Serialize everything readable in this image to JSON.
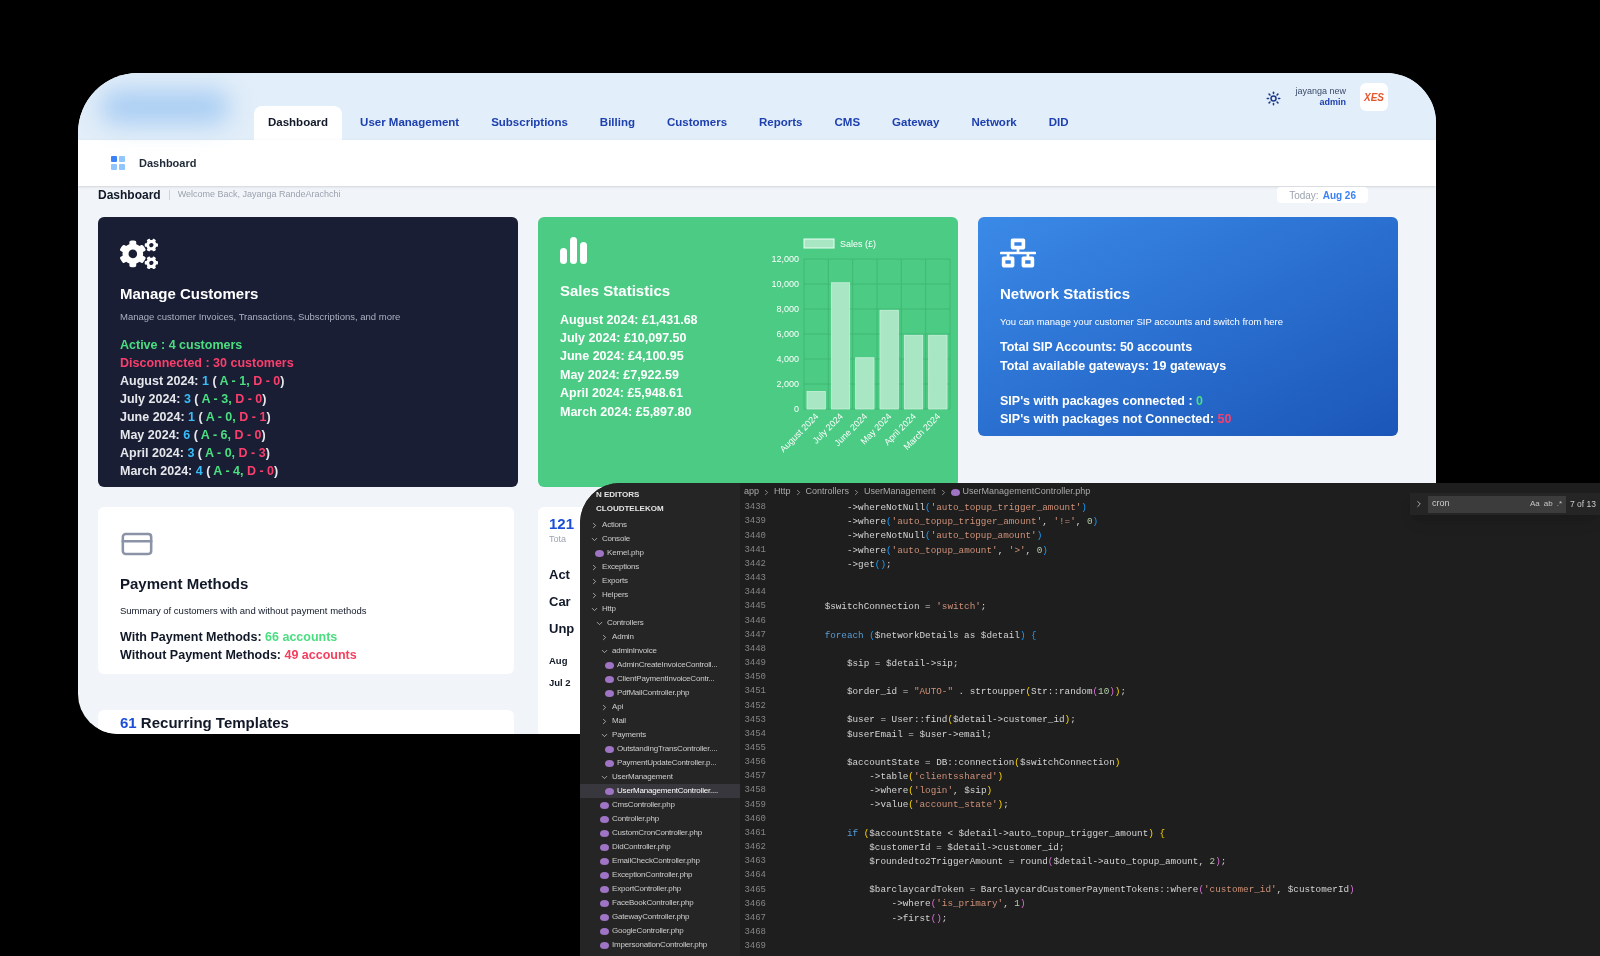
{
  "dashboard": {
    "user": {
      "name": "jayanga new",
      "role": "admin",
      "avatar": "XES"
    },
    "tabs": [
      {
        "label": "Dashboard",
        "selected": true
      },
      {
        "label": "User Management",
        "selected": false
      },
      {
        "label": "Subscriptions",
        "selected": false
      },
      {
        "label": "Billing",
        "selected": false
      },
      {
        "label": "Customers",
        "selected": false
      },
      {
        "label": "Reports",
        "selected": false
      },
      {
        "label": "CMS",
        "selected": false
      },
      {
        "label": "Gateway",
        "selected": false
      },
      {
        "label": "Network",
        "selected": false
      },
      {
        "label": "DID",
        "selected": false
      }
    ],
    "breadcrumb": "Dashboard",
    "page_title": "Dashboard",
    "welcome": "Welcome Back, Jayanga RandeArachchi",
    "today_label": "Today:",
    "today_value": "Aug 26",
    "manage_customers": {
      "title": "Manage Customers",
      "subtitle": "Manage customer Invoices, Transactions, Subscriptions, and more",
      "lines": [
        {
          "segments": [
            {
              "text": "Active : 4 customers",
              "kind": "active"
            }
          ]
        },
        {
          "segments": [
            {
              "text": "Disconnected : 30 customers",
              "kind": "disconnected"
            }
          ]
        },
        {
          "segments": [
            {
              "text": "August 2024: ",
              "kind": "label"
            },
            {
              "text": "1",
              "kind": "count"
            },
            {
              "text": " ( ",
              "kind": "label"
            },
            {
              "text": "A - 1,",
              "kind": "active"
            },
            {
              "text": " D - 0",
              "kind": "disconnected"
            },
            {
              "text": ")",
              "kind": "label"
            }
          ]
        },
        {
          "segments": [
            {
              "text": "July 2024: ",
              "kind": "label"
            },
            {
              "text": "3",
              "kind": "count"
            },
            {
              "text": " ( ",
              "kind": "label"
            },
            {
              "text": "A - 3,",
              "kind": "active"
            },
            {
              "text": " D - 0",
              "kind": "disconnected"
            },
            {
              "text": ")",
              "kind": "label"
            }
          ]
        },
        {
          "segments": [
            {
              "text": "June 2024: ",
              "kind": "label"
            },
            {
              "text": "1",
              "kind": "count"
            },
            {
              "text": " ( ",
              "kind": "label"
            },
            {
              "text": "A - 0,",
              "kind": "active"
            },
            {
              "text": " D - 1",
              "kind": "disconnected"
            },
            {
              "text": ")",
              "kind": "label"
            }
          ]
        },
        {
          "segments": [
            {
              "text": "May 2024: ",
              "kind": "label"
            },
            {
              "text": "6",
              "kind": "count"
            },
            {
              "text": " ( ",
              "kind": "label"
            },
            {
              "text": "A - 6,",
              "kind": "active"
            },
            {
              "text": " D - 0",
              "kind": "disconnected"
            },
            {
              "text": ")",
              "kind": "label"
            }
          ]
        },
        {
          "segments": [
            {
              "text": "April 2024: ",
              "kind": "label"
            },
            {
              "text": "3",
              "kind": "count"
            },
            {
              "text": " ( ",
              "kind": "label"
            },
            {
              "text": "A - 0,",
              "kind": "active"
            },
            {
              "text": " D - 3",
              "kind": "disconnected"
            },
            {
              "text": ")",
              "kind": "label"
            }
          ]
        },
        {
          "segments": [
            {
              "text": "March 2024: ",
              "kind": "label"
            },
            {
              "text": "4",
              "kind": "count"
            },
            {
              "text": " ( ",
              "kind": "label"
            },
            {
              "text": "A - 4,",
              "kind": "active"
            },
            {
              "text": " D - 0",
              "kind": "disconnected"
            },
            {
              "text": ")",
              "kind": "label"
            }
          ]
        }
      ]
    },
    "sales_statistics": {
      "title": "Sales Statistics",
      "lines": [
        "August 2024: £1,431.68",
        "July 2024: £10,097.50",
        "June 2024: £4,100.95",
        "May 2024: £7,922.59",
        "April 2024: £5,948.61",
        "March 2024: £5,897.80"
      ],
      "chart_data": {
        "type": "bar",
        "grid": true,
        "categories": [
          "August 2024",
          "July 2024",
          "June 2024",
          "May 2024",
          "April 2024",
          "March 2024"
        ],
        "series": [
          {
            "name": "Sales (£)",
            "color": "#a8e6c4",
            "values": [
              1400,
              10100,
              4100,
              7900,
              5900,
              5900
            ]
          }
        ],
        "ylim": [
          0,
          12000
        ],
        "yticks": [
          {
            "value": 0,
            "label": "0"
          },
          {
            "value": 2000,
            "label": "2,000"
          },
          {
            "value": 4000,
            "label": "4,000"
          },
          {
            "value": 6000,
            "label": "6,000"
          },
          {
            "value": 8000,
            "label": "8,000"
          },
          {
            "value": 10000,
            "label": "10,000"
          },
          {
            "value": 12000,
            "label": "12,000"
          }
        ]
      }
    },
    "network_statistics": {
      "title": "Network Statistics",
      "subtitle": "You can manage your customer SIP accounts and switch from here",
      "totals": [
        "Total SIP Accounts: 50 accounts",
        "Total available gateways: 19 gateways"
      ],
      "lines": [
        {
          "segments": [
            {
              "text": "SIP's with packages connected : ",
              "kind": "label"
            },
            {
              "text": "0",
              "kind": "active"
            }
          ]
        },
        {
          "segments": [
            {
              "text": "SIP's with packages not Connected: ",
              "kind": "label"
            },
            {
              "text": "50",
              "kind": "disconnected"
            }
          ]
        }
      ]
    },
    "payment_methods": {
      "title": "Payment Methods",
      "subtitle": "Summary of customers with and without payment methods",
      "lines": [
        {
          "segments": [
            {
              "text": "With Payment Methods: ",
              "kind": "label"
            },
            {
              "text": "66 accounts",
              "kind": "active"
            }
          ]
        },
        {
          "segments": [
            {
              "text": "Without Payment Methods: ",
              "kind": "label"
            },
            {
              "text": "49 accounts",
              "kind": "disconnected"
            }
          ]
        }
      ]
    },
    "partial_card": {
      "total": "121",
      "total_label": "Tota",
      "items": [
        "Act",
        "Car",
        "Unp"
      ],
      "months": [
        "Aug",
        "Jul 2"
      ]
    },
    "recurring": {
      "count": "61",
      "label": "Recurring Templates"
    }
  },
  "editor": {
    "explorer_headers": [
      "N EDITORS",
      "CLOUDTELEKOM"
    ],
    "tree": [
      {
        "label": "Actions",
        "kind": "folder",
        "expanded": false,
        "selected": false
      },
      {
        "label": "Console",
        "kind": "folder",
        "expanded": true,
        "selected": false,
        "children": [
          {
            "label": "Kernel.php",
            "kind": "file",
            "selected": false
          }
        ]
      },
      {
        "label": "Exceptions",
        "kind": "folder",
        "expanded": false,
        "selected": false
      },
      {
        "label": "Exports",
        "kind": "folder",
        "expanded": false,
        "selected": false
      },
      {
        "label": "Helpers",
        "kind": "folder",
        "expanded": false,
        "selected": false
      },
      {
        "label": "Http",
        "kind": "folder",
        "expanded": true,
        "selected": false,
        "children": [
          {
            "label": "Controllers",
            "kind": "folder",
            "expanded": true,
            "selected": false,
            "children": [
              {
                "label": "Admin",
                "kind": "folder",
                "expanded": false,
                "selected": false
              },
              {
                "label": "adminInvoice",
                "kind": "folder",
                "expanded": true,
                "selected": false,
                "children": [
                  {
                    "label": "AdminCreateInvoiceControll...",
                    "kind": "file",
                    "selected": false
                  },
                  {
                    "label": "ClientPaymentInvoiceContr...",
                    "kind": "file",
                    "selected": false
                  },
                  {
                    "label": "PdfMailController.php",
                    "kind": "file",
                    "selected": false
                  }
                ]
              },
              {
                "label": "Api",
                "kind": "folder",
                "expanded": false,
                "selected": false
              },
              {
                "label": "Mail",
                "kind": "folder",
                "expanded": false,
                "selected": false
              },
              {
                "label": "Payments",
                "kind": "folder",
                "expanded": true,
                "selected": false,
                "children": [
                  {
                    "label": "OutstandingTransController....",
                    "kind": "file",
                    "selected": false
                  },
                  {
                    "label": "PaymentUpdateController.p...",
                    "kind": "file",
                    "selected": false
                  }
                ]
              },
              {
                "label": "UserManagement",
                "kind": "folder",
                "expanded": true,
                "selected": false,
                "children": [
                  {
                    "label": "UserManagementController....",
                    "kind": "file",
                    "selected": true
                  }
                ]
              },
              {
                "label": "CmsController.php",
                "kind": "file",
                "selected": false
              },
              {
                "label": "Controller.php",
                "kind": "file",
                "selected": false
              },
              {
                "label": "CustomCronController.php",
                "kind": "file",
                "selected": false
              },
              {
                "label": "DidController.php",
                "kind": "file",
                "selected": false
              },
              {
                "label": "EmailCheckController.php",
                "kind": "file",
                "selected": false
              },
              {
                "label": "ExceptionController.php",
                "kind": "file",
                "selected": false
              },
              {
                "label": "ExportController.php",
                "kind": "file",
                "selected": false
              },
              {
                "label": "FaceBookController.php",
                "kind": "file",
                "selected": false
              },
              {
                "label": "GatewayController.php",
                "kind": "file",
                "selected": false
              },
              {
                "label": "GoogleController.php",
                "kind": "file",
                "selected": false
              },
              {
                "label": "ImpersonationController.php",
                "kind": "file",
                "selected": false
              }
            ]
          }
        ]
      }
    ],
    "breadcrumb": [
      "app",
      "Http",
      "Controllers",
      "UserManagement",
      "UserManagementController.php"
    ],
    "find": {
      "value": "cron",
      "toggles": [
        "Aa",
        "ab",
        ".*"
      ],
      "count": "7 of 13"
    },
    "lines": [
      {
        "number": "3438",
        "segments": [
          {
            "text": "            ->whereNotNull",
            "kind": "plain"
          },
          {
            "text": "(",
            "kind": "p3"
          },
          {
            "text": "'auto_topup_trigger_amount'",
            "kind": "string"
          },
          {
            "text": ")",
            "kind": "p3"
          }
        ]
      },
      {
        "number": "3439",
        "segments": [
          {
            "text": "            ->where",
            "kind": "plain"
          },
          {
            "text": "(",
            "kind": "p3"
          },
          {
            "text": "'auto_topup_trigger_amount'",
            "kind": "string"
          },
          {
            "text": ", ",
            "kind": "plain"
          },
          {
            "text": "'!='",
            "kind": "string"
          },
          {
            "text": ", ",
            "kind": "plain"
          },
          {
            "text": "0",
            "kind": "number"
          },
          {
            "text": ")",
            "kind": "p3"
          }
        ]
      },
      {
        "number": "3440",
        "segments": [
          {
            "text": "            ->whereNotNull",
            "kind": "plain"
          },
          {
            "text": "(",
            "kind": "p3"
          },
          {
            "text": "'auto_topup_amount'",
            "kind": "string"
          },
          {
            "text": ")",
            "kind": "p3"
          }
        ]
      },
      {
        "number": "3441",
        "segments": [
          {
            "text": "            ->where",
            "kind": "plain"
          },
          {
            "text": "(",
            "kind": "p3"
          },
          {
            "text": "'auto_topup_amount'",
            "kind": "string"
          },
          {
            "text": ", ",
            "kind": "plain"
          },
          {
            "text": "'>'",
            "kind": "string"
          },
          {
            "text": ", ",
            "kind": "plain"
          },
          {
            "text": "0",
            "kind": "number"
          },
          {
            "text": ")",
            "kind": "p3"
          }
        ]
      },
      {
        "number": "3442",
        "segments": [
          {
            "text": "            ->get",
            "kind": "plain"
          },
          {
            "text": "()",
            "kind": "p3"
          },
          {
            "text": ";",
            "kind": "plain"
          }
        ]
      },
      {
        "number": "3443"
      },
      {
        "number": "3444"
      },
      {
        "number": "3445",
        "segments": [
          {
            "text": "        $switchConnection = ",
            "kind": "plain"
          },
          {
            "text": "'switch'",
            "kind": "string"
          },
          {
            "text": ";",
            "kind": "plain"
          }
        ]
      },
      {
        "number": "3446"
      },
      {
        "number": "3447",
        "segments": [
          {
            "text": "        foreach",
            "kind": "keyword"
          },
          {
            "text": " (",
            "kind": "p3"
          },
          {
            "text": "$networkDetails as $detail",
            "kind": "plain"
          },
          {
            "text": ")",
            "kind": "p3"
          },
          {
            "text": " {",
            "kind": "p3"
          }
        ]
      },
      {
        "number": "3448"
      },
      {
        "number": "3449",
        "segments": [
          {
            "text": "            $sip = $detail->sip;",
            "kind": "plain"
          }
        ]
      },
      {
        "number": "3450"
      },
      {
        "number": "3451",
        "segments": [
          {
            "text": "            $order_id = ",
            "kind": "plain"
          },
          {
            "text": "\"AUTO-\"",
            "kind": "string"
          },
          {
            "text": " . strtoupper",
            "kind": "plain"
          },
          {
            "text": "(",
            "kind": "p1"
          },
          {
            "text": "Str::random",
            "kind": "plain"
          },
          {
            "text": "(",
            "kind": "p2"
          },
          {
            "text": "10",
            "kind": "number"
          },
          {
            "text": ")",
            "kind": "p2"
          },
          {
            "text": ")",
            "kind": "p1"
          },
          {
            "text": ";",
            "kind": "plain"
          }
        ]
      },
      {
        "number": "3452"
      },
      {
        "number": "3453",
        "segments": [
          {
            "text": "            $user = User::find",
            "kind": "plain"
          },
          {
            "text": "(",
            "kind": "p1"
          },
          {
            "text": "$detail->customer_id",
            "kind": "plain"
          },
          {
            "text": ")",
            "kind": "p1"
          },
          {
            "text": ";",
            "kind": "plain"
          }
        ]
      },
      {
        "number": "3454",
        "segments": [
          {
            "text": "            $userEmail = $user->email;",
            "kind": "plain"
          }
        ]
      },
      {
        "number": "3455"
      },
      {
        "number": "3456",
        "segments": [
          {
            "text": "            $accountState = DB::connection",
            "kind": "plain"
          },
          {
            "text": "(",
            "kind": "p1"
          },
          {
            "text": "$switchConnection",
            "kind": "plain"
          },
          {
            "text": ")",
            "kind": "p1"
          }
        ]
      },
      {
        "number": "3457",
        "segments": [
          {
            "text": "                ->table",
            "kind": "plain"
          },
          {
            "text": "(",
            "kind": "p1"
          },
          {
            "text": "'clientsshared'",
            "kind": "string"
          },
          {
            "text": ")",
            "kind": "p1"
          }
        ]
      },
      {
        "number": "3458",
        "segments": [
          {
            "text": "                ->where",
            "kind": "plain"
          },
          {
            "text": "(",
            "kind": "p1"
          },
          {
            "text": "'login'",
            "kind": "string"
          },
          {
            "text": ", $sip",
            "kind": "plain"
          },
          {
            "text": ")",
            "kind": "p1"
          }
        ]
      },
      {
        "number": "3459",
        "segments": [
          {
            "text": "                ->value",
            "kind": "plain"
          },
          {
            "text": "(",
            "kind": "p1"
          },
          {
            "text": "'account_state'",
            "kind": "string"
          },
          {
            "text": ")",
            "kind": "p1"
          },
          {
            "text": ";",
            "kind": "plain"
          }
        ]
      },
      {
        "number": "3460"
      },
      {
        "number": "3461",
        "segments": [
          {
            "text": "            if",
            "kind": "keyword"
          },
          {
            "text": " (",
            "kind": "p1"
          },
          {
            "text": "$accountState < $detail->auto_topup_trigger_amount",
            "kind": "plain"
          },
          {
            "text": ")",
            "kind": "p1"
          },
          {
            "text": " {",
            "kind": "p1"
          }
        ]
      },
      {
        "number": "3462",
        "segments": [
          {
            "text": "                $customerId = $detail->customer_id;",
            "kind": "plain"
          }
        ]
      },
      {
        "number": "3463",
        "segments": [
          {
            "text": "                $roundedto2TriggerAmount = round",
            "kind": "plain"
          },
          {
            "text": "(",
            "kind": "p2"
          },
          {
            "text": "$detail->auto_topup_amount, ",
            "kind": "plain"
          },
          {
            "text": "2",
            "kind": "number"
          },
          {
            "text": ")",
            "kind": "p2"
          },
          {
            "text": ";",
            "kind": "plain"
          }
        ]
      },
      {
        "number": "3464"
      },
      {
        "number": "3465",
        "segments": [
          {
            "text": "                $barclaycardToken = BarclaycardCustomerPaymentTokens::where",
            "kind": "plain"
          },
          {
            "text": "(",
            "kind": "p2"
          },
          {
            "text": "'customer_id'",
            "kind": "string"
          },
          {
            "text": ", $customerId",
            "kind": "plain"
          },
          {
            "text": ")",
            "kind": "p2"
          }
        ]
      },
      {
        "number": "3466",
        "segments": [
          {
            "text": "                    ->where",
            "kind": "plain"
          },
          {
            "text": "(",
            "kind": "p2"
          },
          {
            "text": "'is_primary'",
            "kind": "string"
          },
          {
            "text": ", ",
            "kind": "plain"
          },
          {
            "text": "1",
            "kind": "number"
          },
          {
            "text": ")",
            "kind": "p2"
          }
        ]
      },
      {
        "number": "3467",
        "segments": [
          {
            "text": "                    ->first",
            "kind": "plain"
          },
          {
            "text": "()",
            "kind": "p2"
          },
          {
            "text": ";",
            "kind": "plain"
          }
        ]
      },
      {
        "number": "3468"
      },
      {
        "number": "3469"
      }
    ]
  }
}
